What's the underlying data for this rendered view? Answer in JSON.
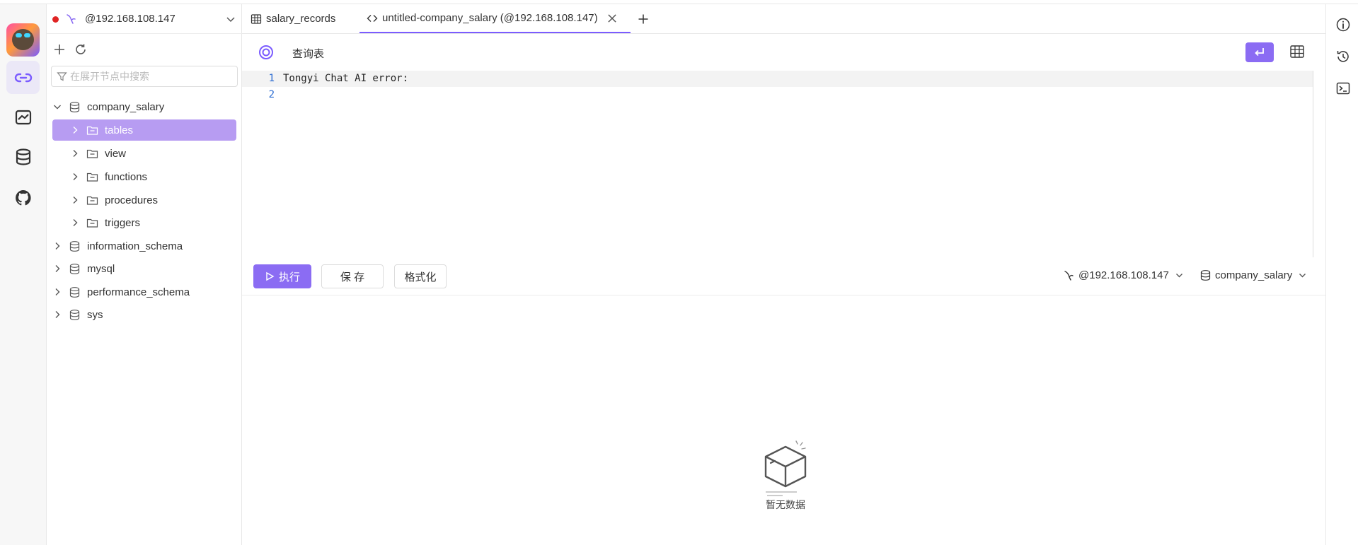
{
  "activity": {
    "items": [
      "connections-icon",
      "dashboard-icon",
      "database-icon",
      "github-icon"
    ]
  },
  "sidebar": {
    "connection": "@192.168.108.147",
    "search_placeholder": "在展开节点中搜索",
    "tree": [
      {
        "label": "company_salary",
        "type": "database",
        "expanded": true
      },
      {
        "label": "tables",
        "type": "folder",
        "selected": true
      },
      {
        "label": "view",
        "type": "folder"
      },
      {
        "label": "functions",
        "type": "folder"
      },
      {
        "label": "procedures",
        "type": "folder"
      },
      {
        "label": "triggers",
        "type": "folder"
      },
      {
        "label": "information_schema",
        "type": "database"
      },
      {
        "label": "mysql",
        "type": "database"
      },
      {
        "label": "performance_schema",
        "type": "database"
      },
      {
        "label": "sys",
        "type": "database"
      }
    ]
  },
  "tabs": [
    {
      "label": "salary_records",
      "icon": "table-icon"
    },
    {
      "label": "untitled-company_salary (@192.168.108.147)",
      "icon": "code-icon",
      "active": true
    }
  ],
  "editor": {
    "query_label": "查询表",
    "lines": [
      {
        "number": "1",
        "text": "Tongyi Chat AI error:"
      },
      {
        "number": "2",
        "text": ""
      }
    ]
  },
  "actions": {
    "run_label": "执行",
    "save_label": "保 存",
    "format_label": "格式化",
    "connection_select": "@192.168.108.147",
    "database_select": "company_salary"
  },
  "results": {
    "empty_text": "暂无数据"
  },
  "colors": {
    "accent": "#8b6cf3",
    "selected_row": "#b79cf2",
    "status_dot": "#e02424"
  }
}
